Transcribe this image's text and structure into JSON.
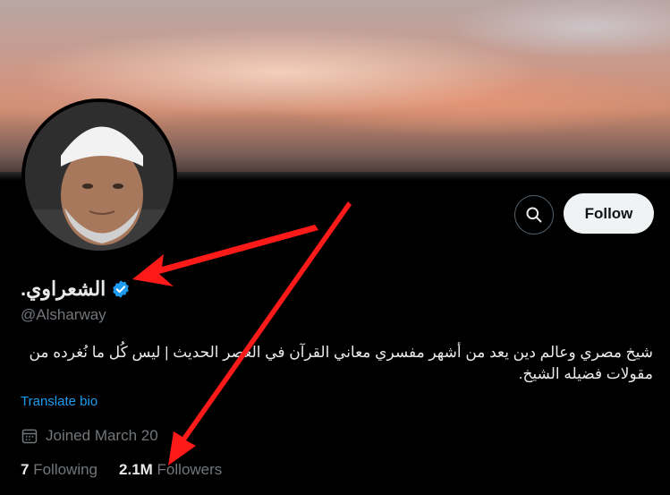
{
  "profile": {
    "display_name": "الشعراوي.",
    "handle": "@Alsharway",
    "bio": "شيخ مصري وعالم دين يعد من أشهر مفسري معاني القرآن في العصر الحديث | ليس كُل ما نُغرده من مقولات فضيله الشيخ.",
    "translate_label": "Translate bio",
    "joined_text": "Joined March 20"
  },
  "actions": {
    "search_icon": "search-icon",
    "follow_label": "Follow"
  },
  "stats": {
    "following_count": "7",
    "following_label": "Following",
    "followers_count": "2.1M",
    "followers_label": "Followers"
  },
  "colors": {
    "background": "#000000",
    "accent": "#1d9bf0",
    "muted_text": "#71767b",
    "annotation_arrow": "#ff0000"
  }
}
